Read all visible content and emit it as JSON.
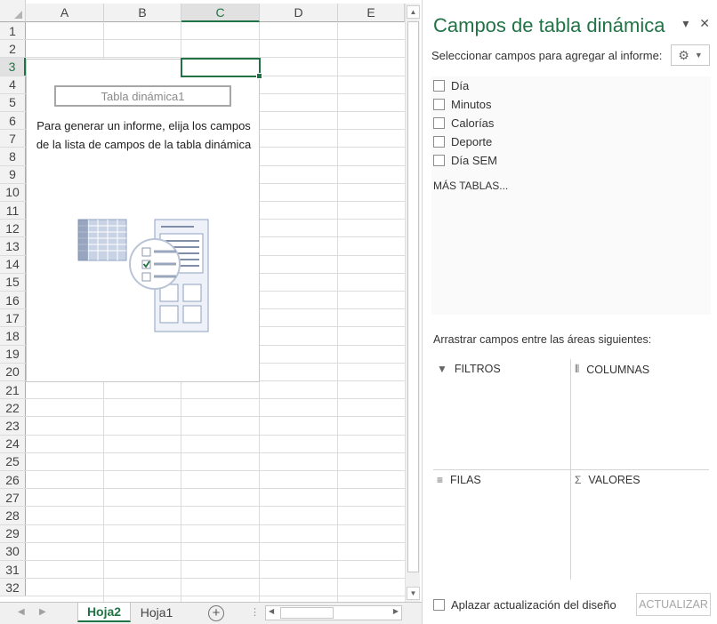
{
  "sheet": {
    "columns": [
      "A",
      "B",
      "C",
      "D",
      "E"
    ],
    "selected_column": "C",
    "rows": [
      "1",
      "2",
      "3",
      "4",
      "5",
      "6",
      "7",
      "8",
      "9",
      "10",
      "11",
      "12",
      "13",
      "14",
      "15",
      "16",
      "17",
      "18",
      "19",
      "20",
      "21",
      "22",
      "23",
      "24",
      "25",
      "26",
      "27",
      "28",
      "29",
      "30",
      "31",
      "32"
    ],
    "selected_row": "3",
    "pivot": {
      "name": "Tabla dinámica1",
      "message": "Para generar un informe, elija los campos de la lista de campos de la tabla dinámica"
    }
  },
  "tabs": [
    {
      "label": "Hoja2",
      "active": true
    },
    {
      "label": "Hoja1",
      "active": false
    }
  ],
  "add_sheet_label": "+",
  "pane": {
    "title": "Campos de tabla dinámica",
    "subtitle": "Seleccionar campos para agregar al informe:",
    "fields": [
      "Día",
      "Minutos",
      "Calorías",
      "Deporte",
      "Día SEM"
    ],
    "more_tables": "MÁS TABLAS...",
    "drag_hint": "Arrastrar campos entre las áreas siguientes:",
    "areas": {
      "filters": "FILTROS",
      "columns": "COLUMNAS",
      "rows": "FILAS",
      "values": "VALORES"
    },
    "defer_label": "Aplazar actualización del diseño",
    "update_button": "ACTUALIZAR"
  },
  "colors": {
    "accent": "#217346",
    "header_bg": "#f2f2f2",
    "gridline": "#dadcdd"
  },
  "icons": {
    "settings": "gear-icon",
    "filter": "filter-icon",
    "columns": "columns-icon",
    "rows": "rows-icon",
    "values": "sigma-icon"
  }
}
